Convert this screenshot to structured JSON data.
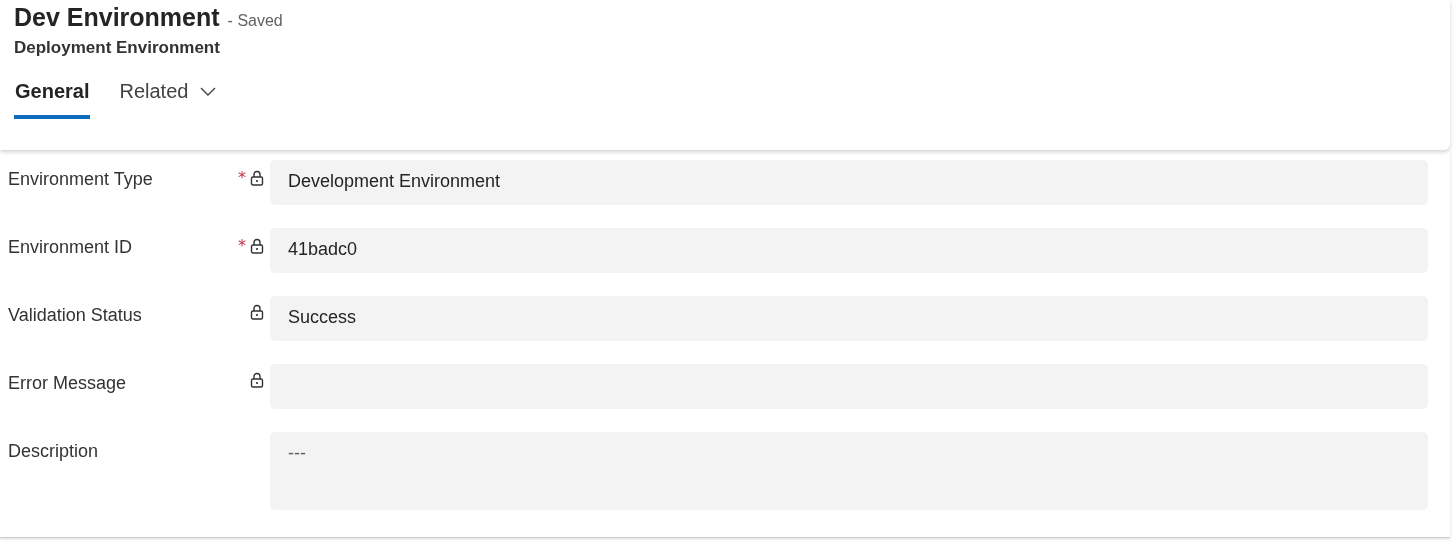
{
  "header": {
    "title": "Dev Environment",
    "status": "- Saved",
    "entity": "Deployment Environment"
  },
  "tabs": [
    {
      "label": "General",
      "selected": true,
      "dropdown": false
    },
    {
      "label": "Related",
      "selected": false,
      "dropdown": true
    }
  ],
  "fields": [
    {
      "label": "Environment Type",
      "required_mark": "*",
      "locked": true,
      "kind": "text",
      "value": "Development Environment"
    },
    {
      "label": "Environment ID",
      "required_mark": "*",
      "locked": true,
      "kind": "text",
      "value": "41badc0"
    },
    {
      "label": "Validation Status",
      "locked": true,
      "kind": "text",
      "value": "Success"
    },
    {
      "label": "Error Message",
      "locked": true,
      "kind": "text"
    },
    {
      "label": "Description",
      "locked": false,
      "kind": "multiline",
      "placeholder": "---"
    }
  ]
}
